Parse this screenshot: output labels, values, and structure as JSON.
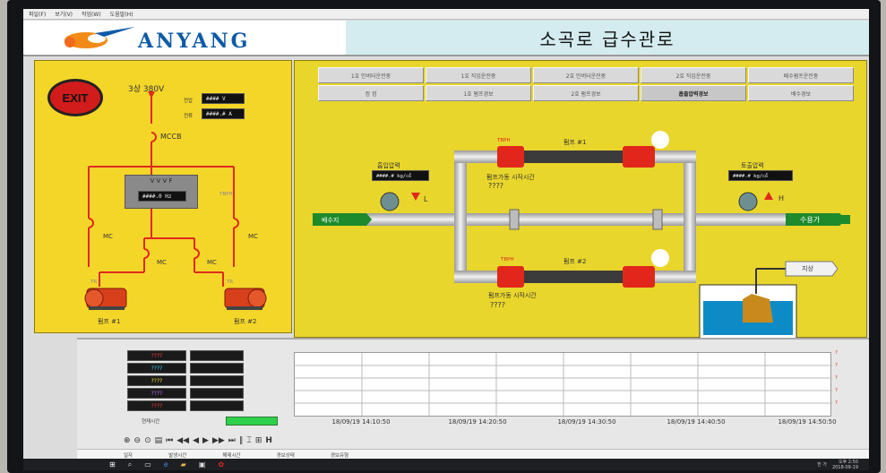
{
  "menu": [
    "파일(F)",
    "보기(V)",
    "작업(W)",
    "도움말(H)"
  ],
  "header": {
    "logo_text": "ANYANG",
    "title": "소곡로 급수관로"
  },
  "left": {
    "exit": "EXIT",
    "source": "3상 380V",
    "voltage_label": "전압",
    "voltage_value": "#### V",
    "current_label": "전류",
    "current_value": "####.# A",
    "mccb": "MCCB",
    "vvvf_title": "V V V F",
    "vvvf_value": "####.0 Hz",
    "mc1": "MC",
    "mc2": "MC",
    "mc3": "MC",
    "mc4": "MC",
    "tbph": "TBPH",
    "tr_left": "TR",
    "tr_right": "TR",
    "pump1": "펌프 #1",
    "pump2": "펌프 #2"
  },
  "buttons": [
    "1호 인버터운전중",
    "1호 직입운전중",
    "2호 인버터운전중",
    "2호 직입운전중",
    "배수펌프운전중",
    "정 정",
    "1호 펌프경보",
    "2호 펌프경보",
    "흡출압력경보",
    "배수경보"
  ],
  "process": {
    "suction_label": "흡입압력",
    "suction_value": "####.# kg/㎠",
    "suction_alarm": "L",
    "discharge_label": "토출압력",
    "discharge_value": "####.# kg/㎠",
    "discharge_alarm": "H",
    "source": "배수지",
    "dest": "수용가",
    "pump1": "펌프 #1",
    "pump2": "펌프 #2",
    "tbph1": "TBPH",
    "tbph2": "TBPH",
    "start_label1": "펌프가동 시작시간",
    "start_value1": "????",
    "start_label2": "펌프가동 시작시간",
    "start_value2": "????",
    "sump_label": "지상"
  },
  "status": {
    "rows": [
      {
        "text": "????",
        "color": "#ff3b3b"
      },
      {
        "text": "????",
        "color": "#35d6ff"
      },
      {
        "text": "????",
        "color": "#ffe23a"
      },
      {
        "text": "????",
        "color": "#b86bff"
      },
      {
        "text": "????",
        "color": "#ff3b3b"
      }
    ],
    "current_time_label": "현재시간"
  },
  "trend": {
    "times": [
      "18/09/19 14:10:50",
      "18/09/19 14:20:50",
      "18/09/19 14:30:50",
      "18/09/19 14:40:50",
      "18/09/19 14:50:50"
    ],
    "marker": "?"
  },
  "alarm_cols": [
    "일자",
    "발생시간",
    "해제시간",
    "경보상태",
    "경보유형"
  ],
  "taskbar": {
    "time": "오후 2:50",
    "date": "2018-09-19",
    "lang": "한 가"
  }
}
